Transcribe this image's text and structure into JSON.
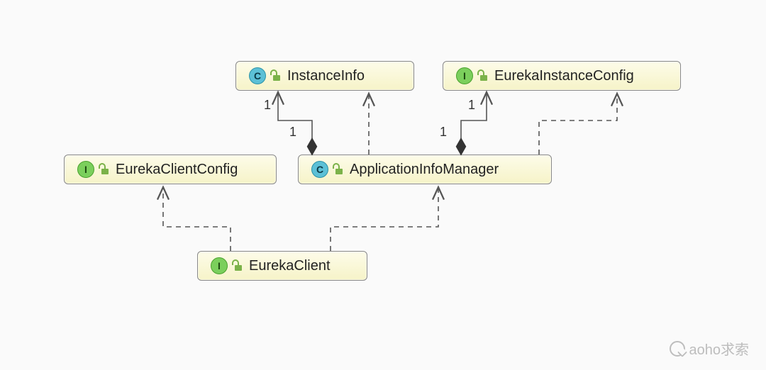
{
  "nodes": {
    "instanceInfo": {
      "label": "InstanceInfo",
      "kind": "class",
      "kindLetter": "C"
    },
    "eurekaInstanceConfig": {
      "label": "EurekaInstanceConfig",
      "kind": "interface",
      "kindLetter": "I"
    },
    "eurekaClientConfig": {
      "label": "EurekaClientConfig",
      "kind": "interface",
      "kindLetter": "I"
    },
    "appInfoManager": {
      "label": "ApplicationInfoManager",
      "kind": "class",
      "kindLetter": "C"
    },
    "eurekaClient": {
      "label": "EurekaClient",
      "kind": "interface",
      "kindLetter": "I"
    }
  },
  "multiplicities": {
    "instanceInfo_end": "1",
    "instanceInfo_src": "1",
    "eurekaInstanceConfig_end": "1",
    "eurekaInstanceConfig_src": "1"
  },
  "edges": [
    {
      "from": "appInfoManager",
      "to": "instanceInfo",
      "type": "composition",
      "mult_from": "1",
      "mult_to": "1"
    },
    {
      "from": "appInfoManager",
      "to": "eurekaInstanceConfig",
      "type": "composition",
      "mult_from": "1",
      "mult_to": "1"
    },
    {
      "from": "appInfoManager",
      "to": "instanceInfo",
      "type": "dependency"
    },
    {
      "from": "appInfoManager",
      "to": "eurekaInstanceConfig",
      "type": "dependency"
    },
    {
      "from": "eurekaClient",
      "to": "eurekaClientConfig",
      "type": "dependency"
    },
    {
      "from": "eurekaClient",
      "to": "appInfoManager",
      "type": "dependency"
    }
  ],
  "watermark": "aoho求索",
  "colors": {
    "boxFill": "#f8f5cf",
    "boxBorder": "#888888",
    "classIcon": "#5cc0d6",
    "interfaceIcon": "#7bcf5c",
    "connector": "#555555"
  }
}
